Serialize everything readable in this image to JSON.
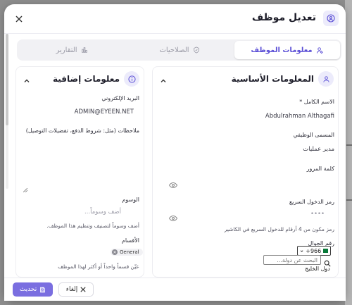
{
  "modal": {
    "title": "تعديل موظف",
    "header_icon": "user-circle-icon",
    "close_icon": "close-icon"
  },
  "tabs": [
    {
      "label": "معلومات الموظف",
      "icon": "user-edit-icon",
      "active": true
    },
    {
      "label": "الصلاحيات",
      "icon": "shield-icon",
      "active": false
    },
    {
      "label": "التقارير",
      "icon": "bar-chart-icon",
      "active": false
    }
  ],
  "basic_info": {
    "title": "المعلومات الأساسية",
    "icon": "user-icon",
    "full_name_label": "الاسم الكامل *",
    "full_name_value": "Abdulrahman Althagafi",
    "job_title_label": "المسمى الوظيفي",
    "job_title_value": "مدير عمليات",
    "password_label": "كلمة المرور",
    "password_value": "",
    "quick_code_label": "رمز الدخول السريع",
    "quick_code_value": "••••",
    "quick_code_help": "رمز مكون من 4 أرقام للدخول السريع في الكاشير",
    "phone_label": "رقم الجوال",
    "phone_code": "+966",
    "country_search_placeholder": "البحث عن دولة...",
    "country_group": "دول الخليج"
  },
  "extra_info": {
    "title": "معلومات إضافية",
    "icon": "info-icon",
    "email_label": "البريد الإلكتروني",
    "email_value": "ADMIN@EYEEN.NET",
    "notes_label": "ملاحظات (مثل: شروط الدفع، تفضيلات التوصيل)",
    "tags_label": "الوسوم",
    "tags_placeholder": "أضف وسوماً...",
    "tags_help": "أضف وسوماً لتصنيف وتنظيم هذا الموظف.",
    "departments_label": "الأقسام",
    "department_chip": "General",
    "departments_help": "عيّن قسماً واحداً أو أكثر لهذا الموظف"
  },
  "footer": {
    "update_label": "تحديث",
    "cancel_label": "إلغاء"
  },
  "colors": {
    "accent": "#7a6ee0",
    "accent_text": "#5b4fd6",
    "icon_bg": "#ecebfb"
  }
}
